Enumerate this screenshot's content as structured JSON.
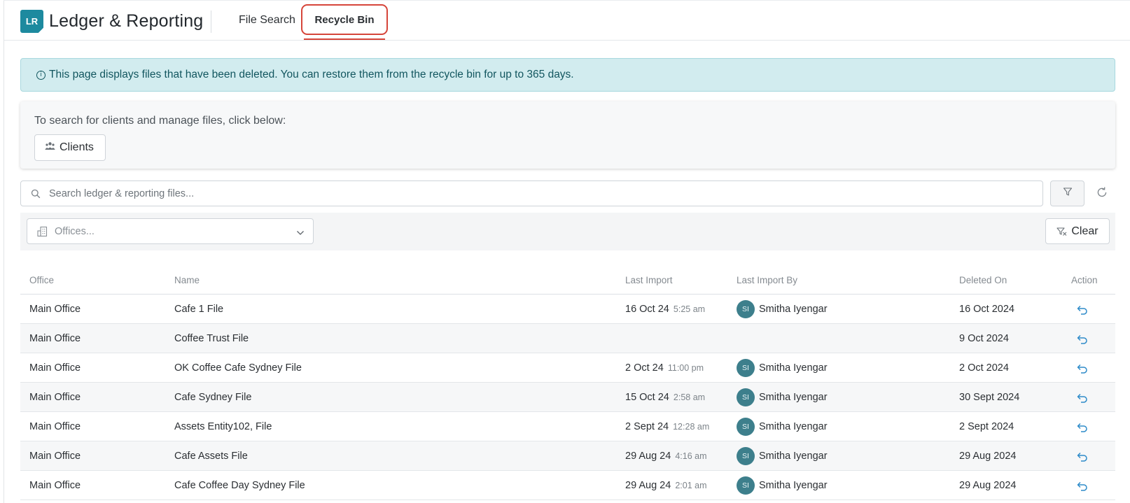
{
  "app": {
    "logo_text": "LR",
    "title": "Ledger & Reporting"
  },
  "tabs": [
    {
      "label": "File Search"
    },
    {
      "label": "Recycle Bin",
      "active": true
    }
  ],
  "info_banner": {
    "icon": "info-icon",
    "text": "This page displays files that have been deleted. You can restore them from the recycle bin for up to 365 days."
  },
  "clients_panel": {
    "prompt": "To search for clients and manage files, click below:",
    "button_label": "Clients",
    "button_icon": "users-icon"
  },
  "search": {
    "placeholder": "Search ledger & reporting files...",
    "value": ""
  },
  "filters": {
    "offices_placeholder": "Offices...",
    "clear_label": "Clear"
  },
  "table": {
    "headers": {
      "office": "Office",
      "name": "Name",
      "last_import": "Last Import",
      "last_import_by": "Last Import By",
      "deleted_on": "Deleted On",
      "action": "Action"
    },
    "rows": [
      {
        "office": "Main Office",
        "name": "Cafe 1 File",
        "import_date": "16 Oct 24",
        "import_time": "5:25 am",
        "user_initials": "SI",
        "user_name": "Smitha Iyengar",
        "deleted_on": "16 Oct 2024"
      },
      {
        "office": "Main Office",
        "name": "Coffee Trust File",
        "import_date": "",
        "import_time": "",
        "user_initials": "",
        "user_name": "",
        "deleted_on": "9 Oct 2024"
      },
      {
        "office": "Main Office",
        "name": "OK Coffee Cafe Sydney File",
        "import_date": "2 Oct 24",
        "import_time": "11:00 pm",
        "user_initials": "SI",
        "user_name": "Smitha Iyengar",
        "deleted_on": "2 Oct 2024"
      },
      {
        "office": "Main Office",
        "name": "Cafe Sydney File",
        "import_date": "15 Oct 24",
        "import_time": "2:58 am",
        "user_initials": "SI",
        "user_name": "Smitha Iyengar",
        "deleted_on": "30 Sept 2024"
      },
      {
        "office": "Main Office",
        "name": "Assets Entity102, File",
        "import_date": "2 Sept 24",
        "import_time": "12:28 am",
        "user_initials": "SI",
        "user_name": "Smitha Iyengar",
        "deleted_on": "2 Sept 2024"
      },
      {
        "office": "Main Office",
        "name": "Cafe Assets File",
        "import_date": "29 Aug 24",
        "import_time": "4:16 am",
        "user_initials": "SI",
        "user_name": "Smitha Iyengar",
        "deleted_on": "29 Aug 2024"
      },
      {
        "office": "Main Office",
        "name": "Cafe Coffee Day Sydney File",
        "import_date": "29 Aug 24",
        "import_time": "2:01 am",
        "user_initials": "SI",
        "user_name": "Smitha Iyengar",
        "deleted_on": "29 Aug 2024"
      }
    ]
  },
  "colors": {
    "brand": "#1d8a9f",
    "active_tab_outline": "#d6453a",
    "info_bg": "#d2ecef",
    "avatar": "#3d7f8c",
    "restore_icon": "#2e8bc9"
  }
}
